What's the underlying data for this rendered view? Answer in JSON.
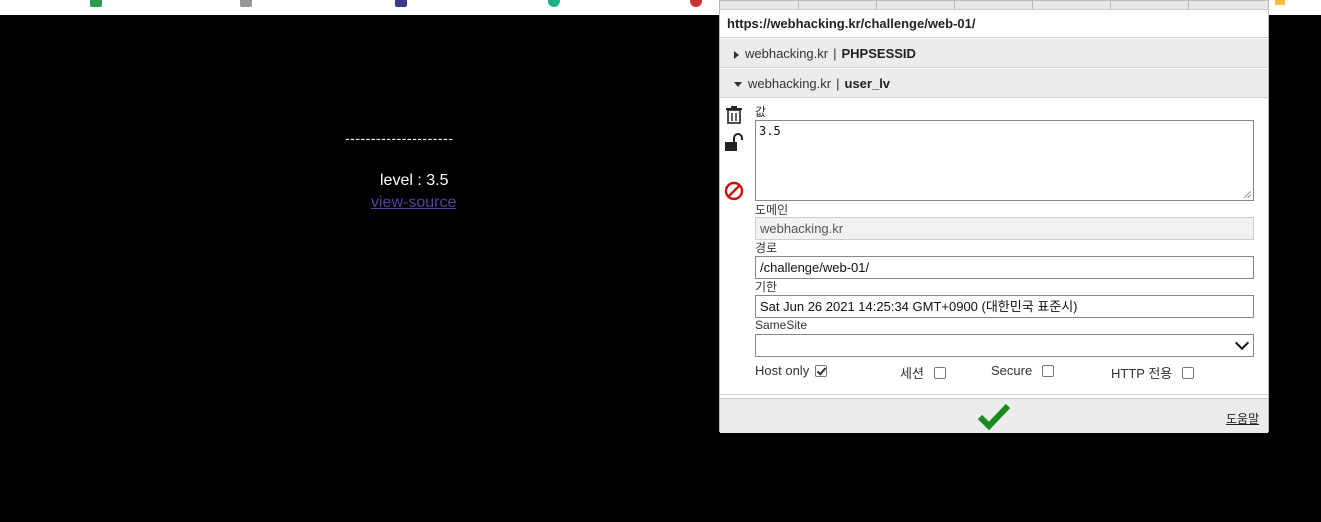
{
  "page": {
    "dashes": "---------------------",
    "level_text": "level : 3.5",
    "view_source_link": "view-source"
  },
  "cookie_editor": {
    "url": "https://webhacking.kr/challenge/web-01/",
    "cookies": [
      {
        "domain": "webhacking.kr",
        "separator": "|",
        "name": "PHPSESSID",
        "expanded": false
      },
      {
        "domain": "webhacking.kr",
        "separator": "|",
        "name": "user_lv",
        "expanded": true
      }
    ],
    "fields": {
      "value_label": "값",
      "value": "3.5",
      "domain_label": "도메인",
      "domain_value": "webhacking.kr",
      "path_label": "경로",
      "path_value": "/challenge/web-01/",
      "expires_label": "기한",
      "expires_value": "Sat Jun 26 2021 14:25:34 GMT+0900 (대한민국 표준시)",
      "samesite_label": "SameSite",
      "samesite_value": ""
    },
    "flags": {
      "host_only": {
        "label": "Host only",
        "checked": true
      },
      "session": {
        "label": "세션",
        "checked": false
      },
      "secure": {
        "label": "Secure",
        "checked": false
      },
      "http_only": {
        "label": "HTTP 전용",
        "checked": false
      }
    },
    "footer": {
      "help_label": "도움말"
    }
  },
  "colors": {
    "save_check": "#1a8a1a",
    "block_icon": "#cc1111",
    "link": "#5a3fa0"
  }
}
